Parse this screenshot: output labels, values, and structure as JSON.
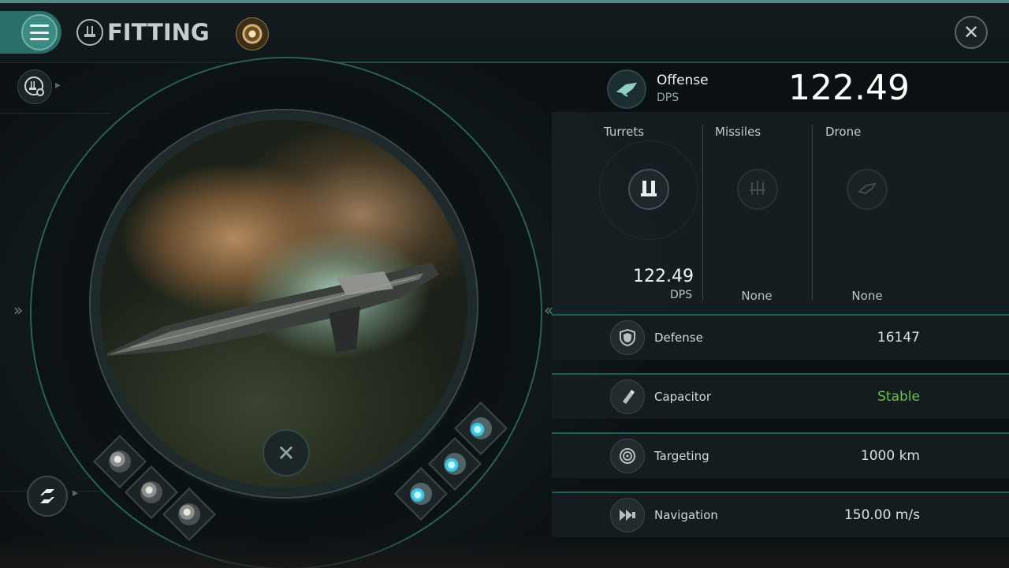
{
  "header": {
    "title": "FITTING",
    "menu_icon": "hamburger-menu-icon",
    "title_icon": "fitting-icon",
    "orb_icon": "currency-orb-icon",
    "close_icon": "close-icon"
  },
  "left_rail": {
    "settings_icon": "fitting-settings-icon",
    "expand_chevron": "»",
    "swap_icon": "swap-ship-icon"
  },
  "ship_view": {
    "collapse_chevron": "«",
    "center_button_icon": "close-icon",
    "low_slots": [
      "grey-module",
      "grey-module",
      "grey-module"
    ],
    "high_slots": [
      "cyan-module",
      "cyan-module",
      "cyan-module"
    ]
  },
  "offense": {
    "label": "Offense",
    "sub": "DPS",
    "value": "122.49",
    "icon": "offense-icon"
  },
  "weapons": [
    {
      "name": "Turrets",
      "value": "122.49",
      "unit": "DPS",
      "icon": "turret-icon",
      "active": true
    },
    {
      "name": "Missiles",
      "value": "None",
      "icon": "missile-icon",
      "active": false
    },
    {
      "name": "Drone",
      "value": "None",
      "icon": "drone-icon",
      "active": false
    }
  ],
  "stats": [
    {
      "label": "Defense",
      "value": "16147",
      "icon": "shield-icon",
      "color": "#d9e0e2"
    },
    {
      "label": "Capacitor",
      "value": "Stable",
      "icon": "capacitor-icon",
      "color": "#6cbe55"
    },
    {
      "label": "Targeting",
      "value": "1000 km",
      "icon": "targeting-icon",
      "color": "#d9e0e2"
    },
    {
      "label": "Navigation",
      "value": "150.00 m/s",
      "icon": "navigation-icon",
      "color": "#d9e0e2"
    }
  ],
  "colors": {
    "accent": "#2b6e67",
    "stable_green": "#6cbe55"
  }
}
